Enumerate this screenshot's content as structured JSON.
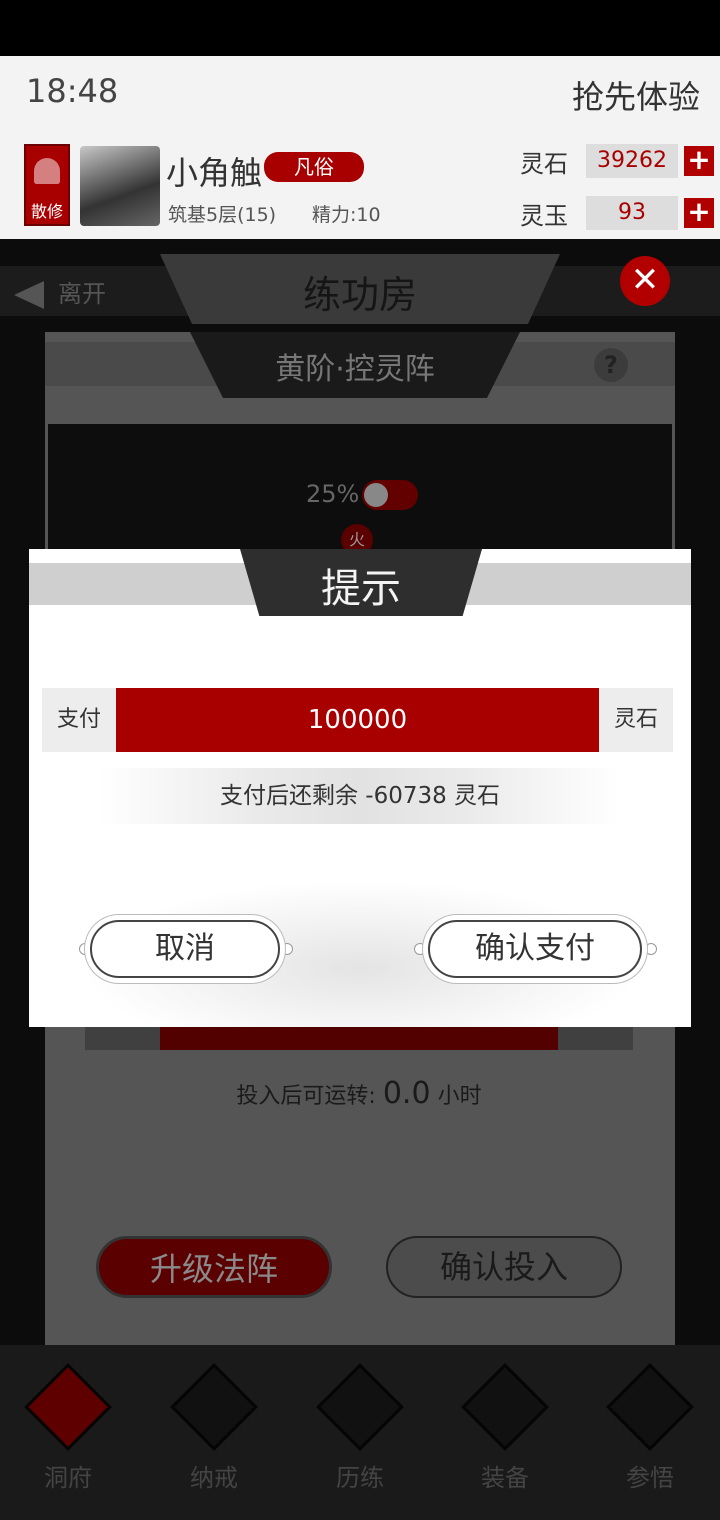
{
  "status_bar": {},
  "header": {
    "clock": "18:48",
    "early_access": "抢先体验",
    "sect_badge": "散修",
    "player_name": "小角触",
    "rank": "凡俗",
    "realm": "筑基5层(15)",
    "energy": "精力:10",
    "currencies": [
      {
        "label": "灵石",
        "value": "39262"
      },
      {
        "label": "灵玉",
        "value": "93"
      }
    ],
    "plus_symbol": "+"
  },
  "background": {
    "leave_label": "离开",
    "room_title": "练功房",
    "close_symbol": "✕",
    "panel_title": "黄阶·控灵阵",
    "help_symbol": "?",
    "percent": "25%",
    "element_badge": "火",
    "runtime_prefix": "投入后可运转:",
    "runtime_value": "0.0",
    "runtime_unit": "小时",
    "upgrade_button": "升级法阵",
    "invest_button": "确认投入"
  },
  "bottom_nav": [
    {
      "label": "洞府",
      "icon": "cave-icon"
    },
    {
      "label": "纳戒",
      "icon": "ring-icon"
    },
    {
      "label": "历练",
      "icon": "swords-icon"
    },
    {
      "label": "装备",
      "icon": "equipment-icon"
    },
    {
      "label": "参悟",
      "icon": "book-icon"
    }
  ],
  "modal": {
    "title": "提示",
    "pay_label": "支付",
    "pay_amount": "100000",
    "pay_unit": "灵石",
    "remaining_text": "支付后还剩余 -60738 灵石",
    "cancel_button": "取消",
    "confirm_button": "确认支付"
  },
  "colors": {
    "accent_red": "#a80000",
    "overlay": "#0c0c0c"
  }
}
